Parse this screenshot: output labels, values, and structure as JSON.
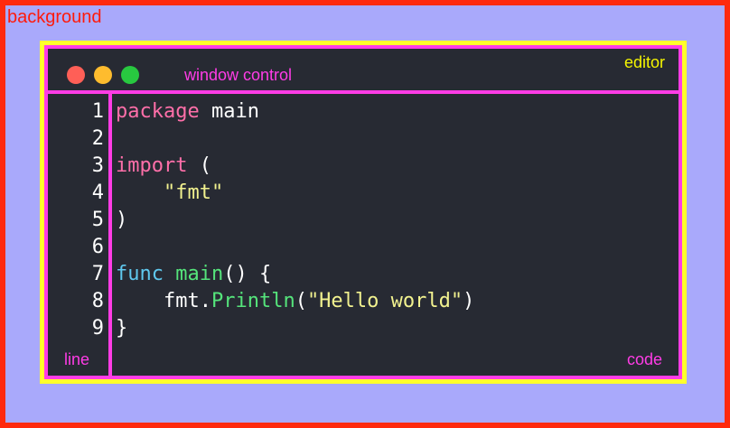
{
  "labels": {
    "background": "background",
    "editor": "editor",
    "window_control": "window control",
    "line": "line",
    "code": "code"
  },
  "colors": {
    "background_border": "#ff2a0e",
    "background_fill": "#a9a9fb",
    "editor_border": "#ffff2a",
    "editor_fill": "#272a33",
    "region_border": "#ff3ce6",
    "close_button": "#ff5f57",
    "minimize_button": "#febc2e",
    "maximize_button": "#28c840",
    "keyword": "#ff6fa9",
    "string": "#f2f28f",
    "function": "#55e47b",
    "func_keyword": "#5fc8ee"
  },
  "window_controls": [
    "close-button",
    "minimize-button",
    "maximize-button"
  ],
  "line_numbers": [
    "1",
    "2",
    "3",
    "4",
    "5",
    "6",
    "7",
    "8",
    "9"
  ],
  "code": {
    "l1_kw": "package",
    "l1_rest": " main",
    "l3_kw": "import",
    "l3_rest": " (",
    "l4_indent": "    ",
    "l4_str": "\"fmt\"",
    "l5": ")",
    "l7_kw": "func",
    "l7_sp": " ",
    "l7_fn": "main",
    "l7_rest": "() {",
    "l8_pre": "    fmt.",
    "l8_fn": "Println",
    "l8_open": "(",
    "l8_str": "\"Hello world\"",
    "l8_close": ")",
    "l9": "}"
  }
}
